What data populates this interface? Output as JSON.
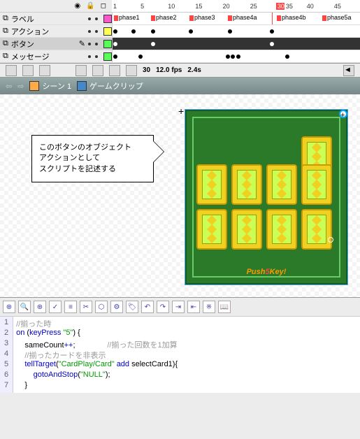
{
  "timeline": {
    "ruler": [
      "1",
      "5",
      "10",
      "15",
      "20",
      "25",
      "30",
      "35",
      "40",
      "45"
    ],
    "current_frame_marker": "30",
    "layers": [
      {
        "name": "ラベル",
        "color": "#ff55cc",
        "labels": [
          "phase1",
          "phase2",
          "phase3",
          "phase4a",
          "phase4b",
          "phase5a"
        ]
      },
      {
        "name": "アクション",
        "color": "#ffff55",
        "labels": []
      },
      {
        "name": "ボタン",
        "color": "#55ff55",
        "active": true,
        "labels": []
      },
      {
        "name": "メッセージ",
        "color": "#55ff55",
        "labels": []
      }
    ],
    "footer": {
      "frame": "30",
      "fps": "12.0 fps",
      "time": "2.4s"
    }
  },
  "breadcrumb": {
    "items": [
      "シーン 1",
      "ゲームクリップ"
    ]
  },
  "callout": {
    "line1": "このボタンのオブジェクト",
    "line2": "アクションとして",
    "line3": "スクリプトを記述する"
  },
  "game": {
    "push_label_a": "Push",
    "push_label_b": "5",
    "push_label_c": "Key!"
  },
  "code": {
    "lines": [
      {
        "n": "1",
        "raw": "//揃った時",
        "cls": "cmt"
      },
      {
        "n": "2",
        "raw": "on (keyPress \"5\") {"
      },
      {
        "n": "3",
        "raw": "    sameCount++;               //揃った回数を1加算"
      },
      {
        "n": "4",
        "raw": "    //揃ったカードを非表示",
        "cls": "cmt"
      },
      {
        "n": "5",
        "raw": "    tellTarget(\"CardPlay/Card\" add selectCard1){"
      },
      {
        "n": "6",
        "raw": "        gotoAndStop(\"NULL\");"
      },
      {
        "n": "7",
        "raw": "    }"
      }
    ]
  }
}
